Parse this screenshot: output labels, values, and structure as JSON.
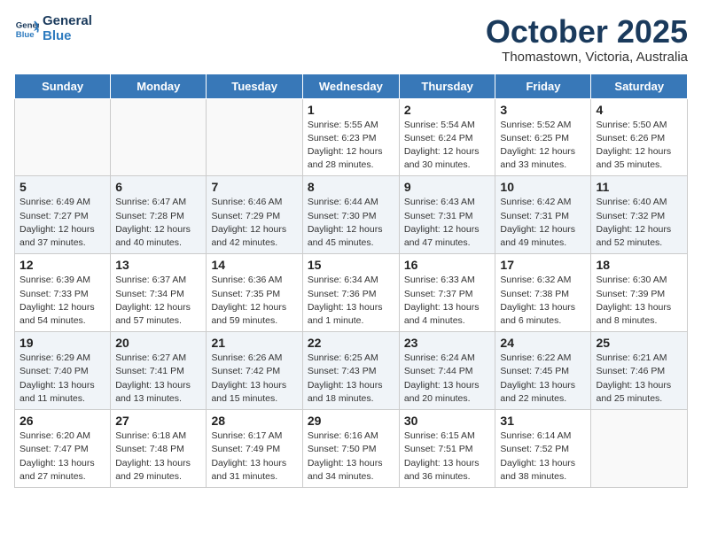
{
  "header": {
    "logo_line1": "General",
    "logo_line2": "Blue",
    "month": "October 2025",
    "location": "Thomastown, Victoria, Australia"
  },
  "weekdays": [
    "Sunday",
    "Monday",
    "Tuesday",
    "Wednesday",
    "Thursday",
    "Friday",
    "Saturday"
  ],
  "weeks": [
    [
      {
        "day": "",
        "info": ""
      },
      {
        "day": "",
        "info": ""
      },
      {
        "day": "",
        "info": ""
      },
      {
        "day": "1",
        "info": "Sunrise: 5:55 AM\nSunset: 6:23 PM\nDaylight: 12 hours\nand 28 minutes."
      },
      {
        "day": "2",
        "info": "Sunrise: 5:54 AM\nSunset: 6:24 PM\nDaylight: 12 hours\nand 30 minutes."
      },
      {
        "day": "3",
        "info": "Sunrise: 5:52 AM\nSunset: 6:25 PM\nDaylight: 12 hours\nand 33 minutes."
      },
      {
        "day": "4",
        "info": "Sunrise: 5:50 AM\nSunset: 6:26 PM\nDaylight: 12 hours\nand 35 minutes."
      }
    ],
    [
      {
        "day": "5",
        "info": "Sunrise: 6:49 AM\nSunset: 7:27 PM\nDaylight: 12 hours\nand 37 minutes."
      },
      {
        "day": "6",
        "info": "Sunrise: 6:47 AM\nSunset: 7:28 PM\nDaylight: 12 hours\nand 40 minutes."
      },
      {
        "day": "7",
        "info": "Sunrise: 6:46 AM\nSunset: 7:29 PM\nDaylight: 12 hours\nand 42 minutes."
      },
      {
        "day": "8",
        "info": "Sunrise: 6:44 AM\nSunset: 7:30 PM\nDaylight: 12 hours\nand 45 minutes."
      },
      {
        "day": "9",
        "info": "Sunrise: 6:43 AM\nSunset: 7:31 PM\nDaylight: 12 hours\nand 47 minutes."
      },
      {
        "day": "10",
        "info": "Sunrise: 6:42 AM\nSunset: 7:31 PM\nDaylight: 12 hours\nand 49 minutes."
      },
      {
        "day": "11",
        "info": "Sunrise: 6:40 AM\nSunset: 7:32 PM\nDaylight: 12 hours\nand 52 minutes."
      }
    ],
    [
      {
        "day": "12",
        "info": "Sunrise: 6:39 AM\nSunset: 7:33 PM\nDaylight: 12 hours\nand 54 minutes."
      },
      {
        "day": "13",
        "info": "Sunrise: 6:37 AM\nSunset: 7:34 PM\nDaylight: 12 hours\nand 57 minutes."
      },
      {
        "day": "14",
        "info": "Sunrise: 6:36 AM\nSunset: 7:35 PM\nDaylight: 12 hours\nand 59 minutes."
      },
      {
        "day": "15",
        "info": "Sunrise: 6:34 AM\nSunset: 7:36 PM\nDaylight: 13 hours\nand 1 minute."
      },
      {
        "day": "16",
        "info": "Sunrise: 6:33 AM\nSunset: 7:37 PM\nDaylight: 13 hours\nand 4 minutes."
      },
      {
        "day": "17",
        "info": "Sunrise: 6:32 AM\nSunset: 7:38 PM\nDaylight: 13 hours\nand 6 minutes."
      },
      {
        "day": "18",
        "info": "Sunrise: 6:30 AM\nSunset: 7:39 PM\nDaylight: 13 hours\nand 8 minutes."
      }
    ],
    [
      {
        "day": "19",
        "info": "Sunrise: 6:29 AM\nSunset: 7:40 PM\nDaylight: 13 hours\nand 11 minutes."
      },
      {
        "day": "20",
        "info": "Sunrise: 6:27 AM\nSunset: 7:41 PM\nDaylight: 13 hours\nand 13 minutes."
      },
      {
        "day": "21",
        "info": "Sunrise: 6:26 AM\nSunset: 7:42 PM\nDaylight: 13 hours\nand 15 minutes."
      },
      {
        "day": "22",
        "info": "Sunrise: 6:25 AM\nSunset: 7:43 PM\nDaylight: 13 hours\nand 18 minutes."
      },
      {
        "day": "23",
        "info": "Sunrise: 6:24 AM\nSunset: 7:44 PM\nDaylight: 13 hours\nand 20 minutes."
      },
      {
        "day": "24",
        "info": "Sunrise: 6:22 AM\nSunset: 7:45 PM\nDaylight: 13 hours\nand 22 minutes."
      },
      {
        "day": "25",
        "info": "Sunrise: 6:21 AM\nSunset: 7:46 PM\nDaylight: 13 hours\nand 25 minutes."
      }
    ],
    [
      {
        "day": "26",
        "info": "Sunrise: 6:20 AM\nSunset: 7:47 PM\nDaylight: 13 hours\nand 27 minutes."
      },
      {
        "day": "27",
        "info": "Sunrise: 6:18 AM\nSunset: 7:48 PM\nDaylight: 13 hours\nand 29 minutes."
      },
      {
        "day": "28",
        "info": "Sunrise: 6:17 AM\nSunset: 7:49 PM\nDaylight: 13 hours\nand 31 minutes."
      },
      {
        "day": "29",
        "info": "Sunrise: 6:16 AM\nSunset: 7:50 PM\nDaylight: 13 hours\nand 34 minutes."
      },
      {
        "day": "30",
        "info": "Sunrise: 6:15 AM\nSunset: 7:51 PM\nDaylight: 13 hours\nand 36 minutes."
      },
      {
        "day": "31",
        "info": "Sunrise: 6:14 AM\nSunset: 7:52 PM\nDaylight: 13 hours\nand 38 minutes."
      },
      {
        "day": "",
        "info": ""
      }
    ]
  ]
}
